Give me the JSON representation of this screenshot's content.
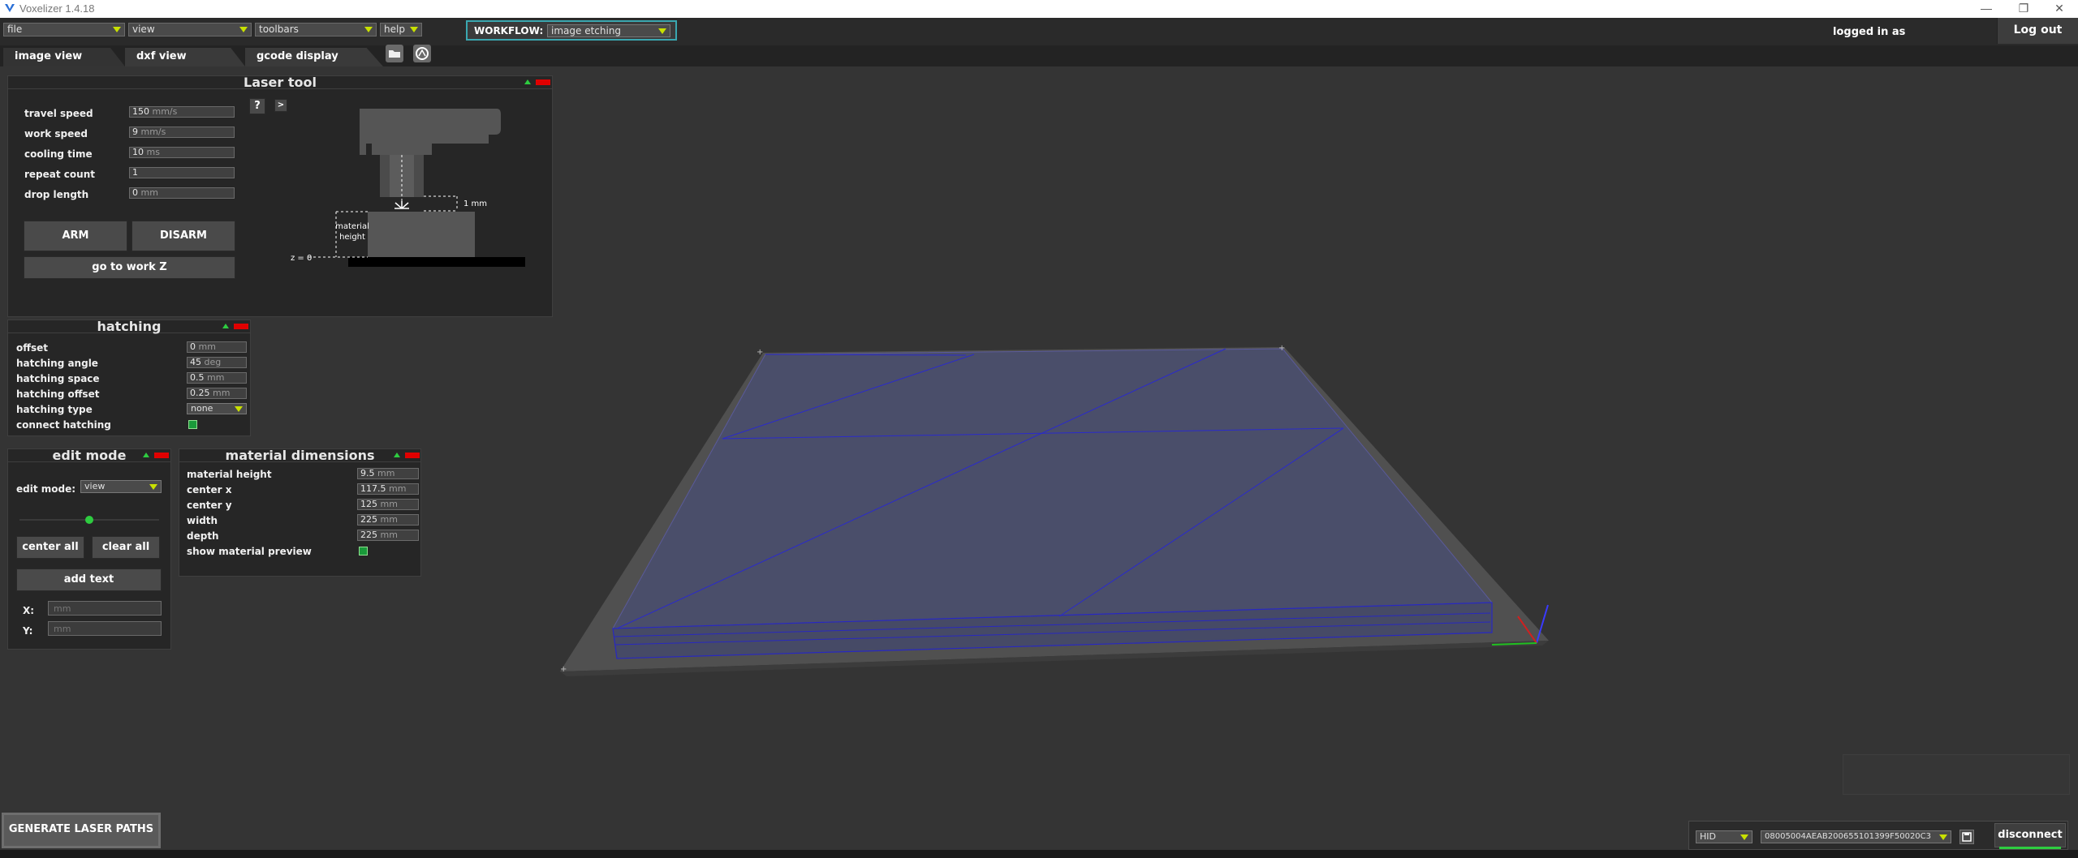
{
  "titlebar": {
    "title": "Voxelizer 1.4.18"
  },
  "menu": {
    "file": "file",
    "view": "view",
    "toolbars": "toolbars",
    "help": "help"
  },
  "workflow": {
    "label": "WORKFLOW:",
    "value": "image etching"
  },
  "account": {
    "logged_in": "logged in as",
    "logout": "Log out"
  },
  "tabs": [
    "image view",
    "dxf view",
    "gcode display"
  ],
  "laser_tool": {
    "title": "Laser tool",
    "help": "?",
    "more": ">",
    "fields": [
      {
        "label": "travel speed",
        "value": "150",
        "unit": "mm/s"
      },
      {
        "label": "work speed",
        "value": "9",
        "unit": "mm/s"
      },
      {
        "label": "cooling time",
        "value": "10",
        "unit": "ms"
      },
      {
        "label": "repeat count",
        "value": "1",
        "unit": ""
      },
      {
        "label": "drop length",
        "value": "0",
        "unit": "mm"
      }
    ],
    "arm": "ARM",
    "disarm": "DISARM",
    "go_to_work_z": "go to work Z",
    "diagram": {
      "offset": "1 mm",
      "material_height": "material height",
      "z0": "z = 0"
    }
  },
  "hatching": {
    "title": "hatching",
    "fields": [
      {
        "label": "offset",
        "value": "0",
        "unit": "mm"
      },
      {
        "label": "hatching angle",
        "value": "45",
        "unit": "deg"
      },
      {
        "label": "hatching space",
        "value": "0.5",
        "unit": "mm"
      },
      {
        "label": "hatching offset",
        "value": "0.25",
        "unit": "mm"
      }
    ],
    "type_label": "hatching type",
    "type_value": "none",
    "connect_label": "connect hatching",
    "connect_checked": true
  },
  "edit_mode": {
    "title": "edit mode",
    "label": "edit mode:",
    "value": "view",
    "slider_level": 0.5,
    "center_all": "center all",
    "clear_all": "clear all",
    "add_text": "add text",
    "x_label": "X:",
    "y_label": "Y:",
    "x_placeholder": "mm",
    "y_placeholder": "mm"
  },
  "material": {
    "title": "material dimensions",
    "fields": [
      {
        "label": "material height",
        "value": "9.5",
        "unit": "mm"
      },
      {
        "label": "center x",
        "value": "117.5",
        "unit": "mm"
      },
      {
        "label": "center y",
        "value": "125",
        "unit": "mm"
      },
      {
        "label": "width",
        "value": "225",
        "unit": "mm"
      },
      {
        "label": "depth",
        "value": "225",
        "unit": "mm"
      }
    ],
    "preview_label": "show material preview",
    "preview_checked": true
  },
  "generate": "GENERATE LASER PATHS",
  "connection": {
    "port_type": "HID",
    "device_id": "08005004AEAB2006551013​99F50020C3",
    "disconnect": "disconnect"
  },
  "colors": {
    "accent_arrow": "#c8e000",
    "workflow_border": "#3aa7b0",
    "checkbox": "#1a9a3a",
    "close_red": "#e00000"
  }
}
